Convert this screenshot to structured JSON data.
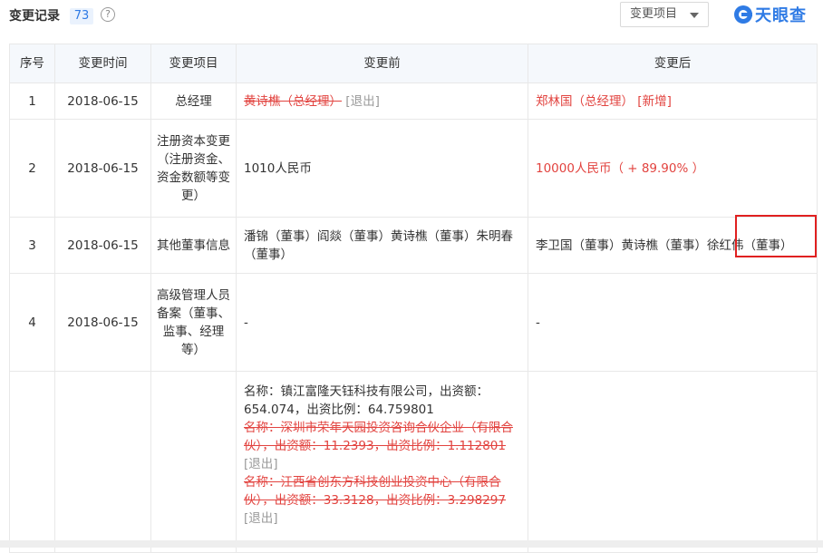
{
  "header": {
    "title": "变更记录",
    "count": "73",
    "help_icon": "?",
    "filter_label": "变更项目",
    "logo_text": "天眼查"
  },
  "columns": [
    "序号",
    "变更时间",
    "变更项目",
    "变更前",
    "变更后"
  ],
  "rows": [
    {
      "index": "1",
      "date": "2018-06-15",
      "item": "总经理",
      "before_strike": "黄诗樵（总经理）",
      "before_tag": "[退出]",
      "after": "郑林国（总经理）",
      "after_tag": "[新增]"
    },
    {
      "index": "2",
      "date": "2018-06-15",
      "item": "注册资本变更（注册资金、资金数额等变更）",
      "before": "1010人民币",
      "after": "10000人民币（ + 89.90% ）"
    },
    {
      "index": "3",
      "date": "2018-06-15",
      "item": "其他董事信息",
      "before": "潘锦（董事）阎燚（董事）黄诗樵（董事）朱明春（董事）",
      "after": "李卫国（董事）黄诗樵（董事）徐红伟（董事）"
    },
    {
      "index": "4",
      "date": "2018-06-15",
      "item": "高级管理人员备案（董事、监事、经理等）",
      "before": "-",
      "after": "-"
    },
    {
      "index": "",
      "date": "",
      "item": "",
      "before_line1": "名称：镇江富隆天钰科技有限公司，出资额：654.074，出资比例：64.759801",
      "before_strike1": "名称：深圳市荣年天园投资咨询合伙企业（有限合伙），出资额：11.2393，出资比例：1.112801",
      "before_tag1": "[退出]",
      "before_strike2": "名称：江西省创东方科技创业投资中心（有限合伙），出资额：33.3128，出资比例：3.298297",
      "before_tag2": "[退出]",
      "after": ""
    }
  ]
}
